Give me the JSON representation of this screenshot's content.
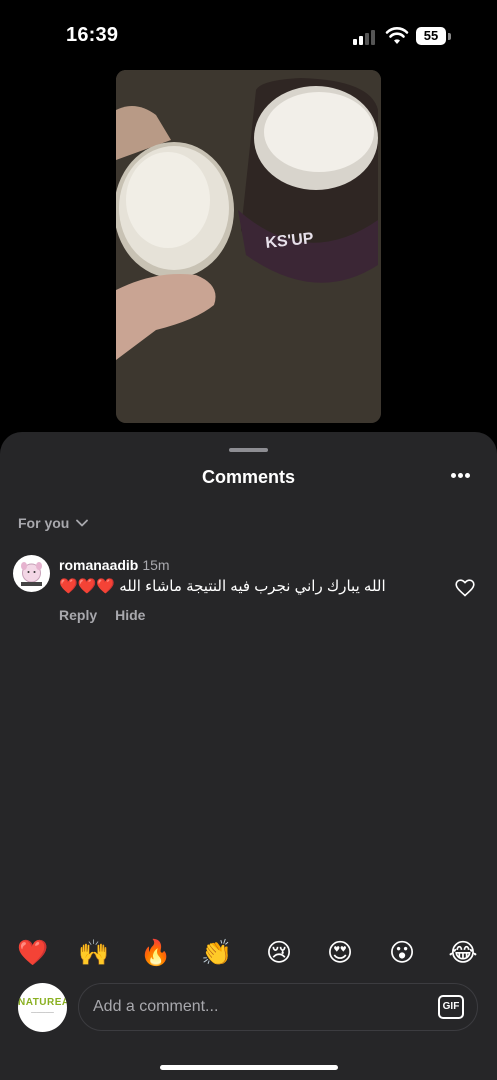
{
  "status_bar": {
    "time": "16:39",
    "battery": "55"
  },
  "video": {
    "jar_label": "KS'UP"
  },
  "sheet": {
    "title": "Comments"
  },
  "filter": {
    "label": "For you"
  },
  "comment": {
    "username": "romanaadib",
    "time": "15m",
    "text": "الله يبارك راني نجرب فيه النتيجة ماشاء الله ❤️❤️❤️",
    "reply_label": "Reply",
    "hide_label": "Hide"
  },
  "reactions": [
    "❤️",
    "🙌",
    "🔥",
    "👏",
    "😢",
    "😍",
    "😮",
    "😂"
  ],
  "composer": {
    "avatar_logo": "NATUREA",
    "placeholder": "Add a comment...",
    "gif_label": "GIF"
  },
  "colors": {
    "sheet_bg": "#262628",
    "muted_text": "#a8a8ad",
    "accent": "#8ab021"
  },
  "icons": [
    "signal-icon",
    "wifi-icon",
    "battery-icon",
    "more-icon",
    "chevron-down-icon",
    "heart-icon",
    "gif-icon"
  ]
}
